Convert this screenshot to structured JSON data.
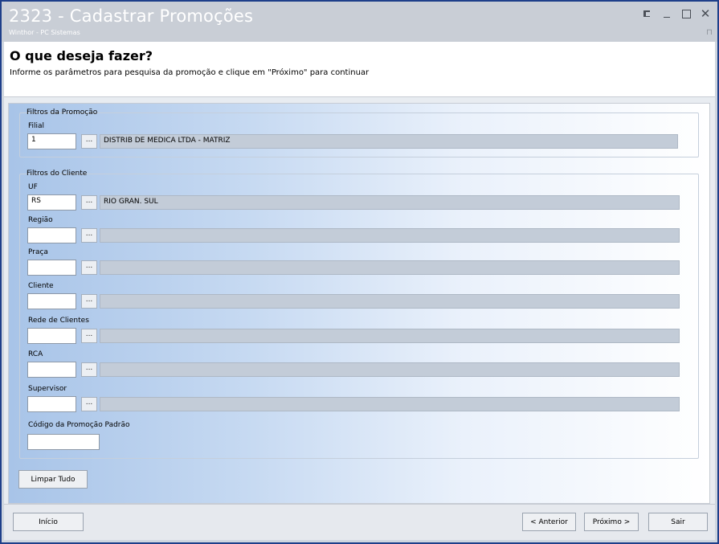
{
  "window": {
    "title": "2323 - Cadastrar Promoções",
    "subtitle": "Winthor - PC Sistemas",
    "controls": [
      "restore-icon",
      "minimize-icon",
      "maximize-icon",
      "close-icon"
    ]
  },
  "header": {
    "title": "O que deseja fazer?",
    "description": "Informe os parâmetros para pesquisa da promoção e clique em \"Próximo\" para continuar"
  },
  "promo_filters": {
    "title": "Filtros da Promoção",
    "filial": {
      "label": "Filial",
      "code": "1",
      "description": "DISTRIB DE MEDICA LTDA - MATRIZ",
      "button": "..."
    }
  },
  "client_filters": {
    "title": "Filtros do Cliente",
    "uf": {
      "label": "UF",
      "code": "RS",
      "description": "RIO GRAN. SUL",
      "button": "..."
    },
    "regiao": {
      "label": "Região",
      "code": "",
      "description": "",
      "button": "..."
    },
    "praca": {
      "label": "Praça",
      "code": "",
      "description": "",
      "button": "..."
    },
    "cliente": {
      "label": "Cliente",
      "code": "",
      "description": "",
      "button": "..."
    },
    "rede": {
      "label": "Rede de Clientes",
      "code": "",
      "description": "",
      "button": "..."
    },
    "rca": {
      "label": "RCA",
      "code": "",
      "description": "",
      "button": "..."
    },
    "supervisor": {
      "label": "Supervisor",
      "code": "",
      "description": "",
      "button": "..."
    },
    "codigo_promocao": {
      "label": "Código da Promoção Padrão",
      "value": ""
    }
  },
  "buttons": {
    "limpar": "Limpar Tudo",
    "inicio": "Início",
    "anterior": "< Anterior",
    "proximo": "Próximo >",
    "sair": "Sair"
  }
}
